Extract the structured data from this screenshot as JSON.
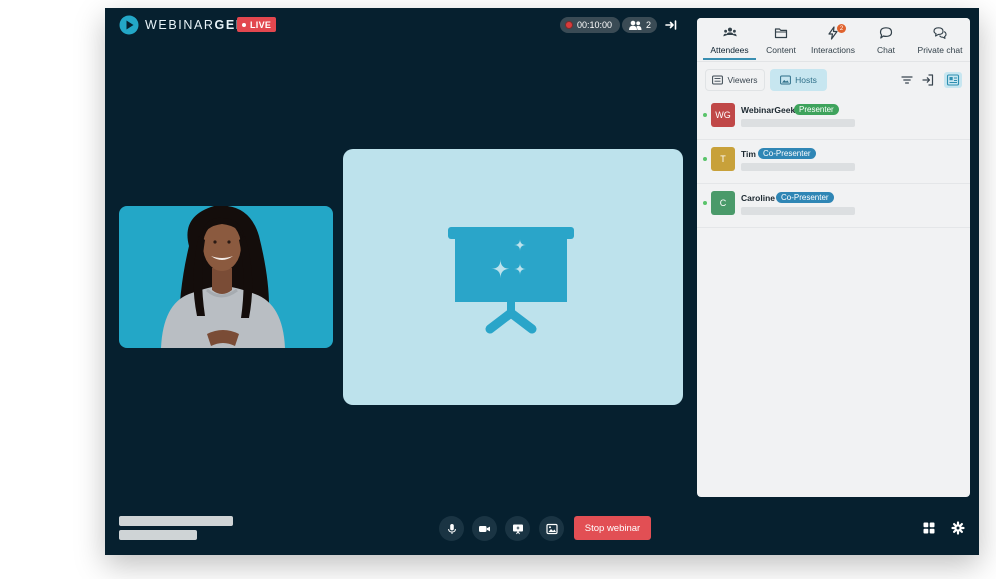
{
  "brand": {
    "name_prefix": "WEBINAR",
    "name_suffix": "GEEK",
    "live_label": "LIVE"
  },
  "header": {
    "timer": "00:10:00",
    "attendee_count": "2"
  },
  "footer": {
    "stop_label": "Stop webinar"
  },
  "panel": {
    "tabs": [
      {
        "label": "Attendees",
        "icon": "attendees-icon",
        "active": true
      },
      {
        "label": "Content",
        "icon": "folder-icon"
      },
      {
        "label": "Interactions",
        "icon": "lightning-icon",
        "badge": "2"
      },
      {
        "label": "Chat",
        "icon": "chat-bubble-icon"
      },
      {
        "label": "Private chat",
        "icon": "private-chat-icon"
      }
    ],
    "segments": {
      "viewers": "Viewers",
      "hosts": "Hosts",
      "selected": "Hosts"
    },
    "hosts": [
      {
        "initials": "WG",
        "name": "WebinarGeek",
        "role": "Presenter",
        "avatar_color": "#c04848",
        "role_color": "#3ea35c",
        "online": true
      },
      {
        "initials": "T",
        "name": "Tim",
        "role": "Co-Presenter",
        "avatar_color": "#c8a13a",
        "role_color": "#2f86b5",
        "online": true
      },
      {
        "initials": "C",
        "name": "Caroline",
        "role": "Co-Presenter",
        "avatar_color": "#4a9a6a",
        "role_color": "#2f86b5",
        "online": true
      }
    ]
  },
  "colors": {
    "background": "#06202f",
    "accent": "#23a7c7",
    "live": "#e2474f",
    "stop": "#e24f54"
  }
}
